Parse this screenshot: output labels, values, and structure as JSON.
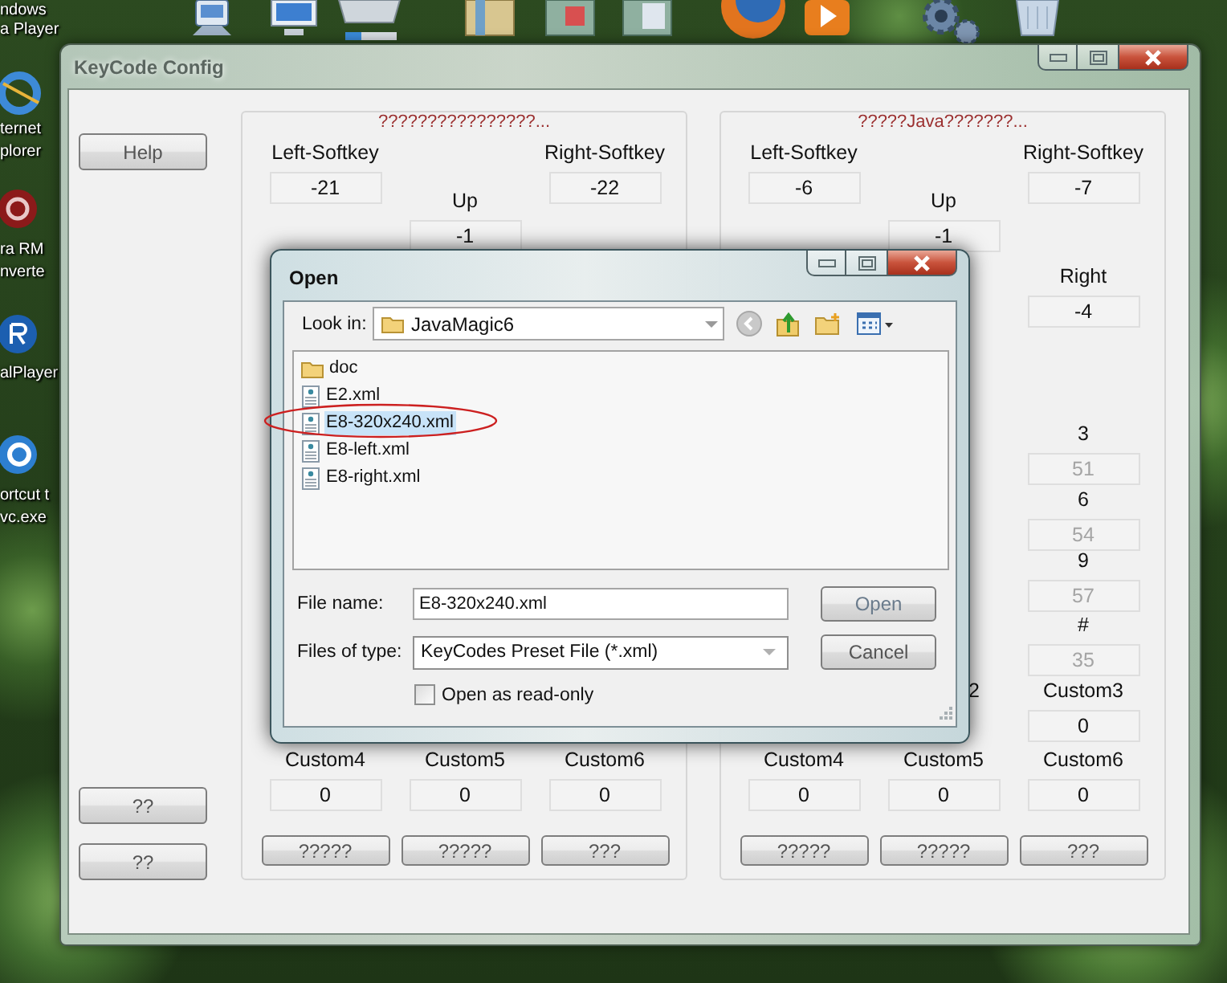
{
  "desktop": {
    "icon_labels": [
      "ndows",
      "a Player",
      "ternet",
      "plorer",
      "ra RM",
      "nverte",
      "alPlayer",
      "ortcut t",
      "vc.exe"
    ]
  },
  "window": {
    "title": "KeyCode Config"
  },
  "side_buttons": [
    "Help",
    "??",
    "??"
  ],
  "groups": [
    {
      "title": "????????????????...",
      "keys": {
        "softkeys": {
          "left": {
            "kind": "key",
            "label": "Left-Softkey",
            "value": "-21",
            "disabled": false
          },
          "right": {
            "kind": "key",
            "label": "Right-Softkey",
            "value": "-22",
            "disabled": false
          }
        },
        "up": {
          "center": {
            "kind": "key",
            "label": "Up",
            "value": "-1",
            "disabled": false
          }
        },
        "custom_4": {
          "left": {
            "kind": "key",
            "label": "Custom4",
            "value": "0",
            "disabled": false
          },
          "center": {
            "kind": "key",
            "label": "Custom5",
            "value": "0",
            "disabled": false
          },
          "right": {
            "kind": "key",
            "label": "Custom6",
            "value": "0",
            "disabled": false
          }
        }
      },
      "buttons": [
        "?????",
        "?????",
        "???"
      ]
    },
    {
      "title": "?????Java???????...",
      "keys": {
        "softkeys": {
          "left": {
            "kind": "key",
            "label": "Left-Softkey",
            "value": "-6",
            "disabled": false
          },
          "right": {
            "kind": "key",
            "label": "Right-Softkey",
            "value": "-7",
            "disabled": false
          }
        },
        "up": {
          "center": {
            "kind": "key",
            "label": "Up",
            "value": "-1",
            "disabled": false
          }
        },
        "sides": {
          "right": {
            "kind": "key",
            "label": "Right",
            "value": "-4",
            "disabled": false
          }
        },
        "keys_1": {
          "right": {
            "kind": "key",
            "label": "3",
            "value": "51",
            "disabled": true
          }
        },
        "keys_4": {
          "right": {
            "kind": "key",
            "label": "6",
            "value": "54",
            "disabled": true
          }
        },
        "keys_7": {
          "right": {
            "kind": "key",
            "label": "9",
            "value": "57",
            "disabled": true
          }
        },
        "keys_star": {
          "right": {
            "kind": "key",
            "label": "#",
            "value": "35",
            "disabled": true
          }
        },
        "custom_1": {
          "center": {
            "kind": "cut_label",
            "label": "2",
            "disabled": false
          },
          "right": {
            "kind": "key",
            "label": "Custom3",
            "value": "0",
            "disabled": false
          }
        },
        "custom_4": {
          "left": {
            "kind": "key",
            "label": "Custom4",
            "value": "0",
            "disabled": false
          },
          "center": {
            "kind": "key",
            "label": "Custom5",
            "value": "0",
            "disabled": false
          },
          "right": {
            "kind": "key",
            "label": "Custom6",
            "value": "0",
            "disabled": false
          }
        }
      },
      "buttons": [
        "?????",
        "?????",
        "???"
      ]
    }
  ],
  "open_dialog": {
    "title": "Open",
    "look_in_label": "Look in:",
    "look_in": "JavaMagic6",
    "files": [
      {
        "name": "doc",
        "kind": "folder",
        "selected": false
      },
      {
        "name": "E2.xml",
        "kind": "xml",
        "selected": false
      },
      {
        "name": "E8-320x240.xml",
        "kind": "xml",
        "selected": true
      },
      {
        "name": "E8-left.xml",
        "kind": "xml",
        "selected": false
      },
      {
        "name": "E8-right.xml",
        "kind": "xml",
        "selected": false
      }
    ],
    "file_name_label": "File name:",
    "file_name": "E8-320x240.xml",
    "file_type_label": "Files of type:",
    "file_type": "KeyCodes Preset File (*.xml)",
    "read_only": {
      "label": "Open as read-only",
      "checked": false
    },
    "buttons": [
      "Open",
      "Cancel"
    ]
  }
}
